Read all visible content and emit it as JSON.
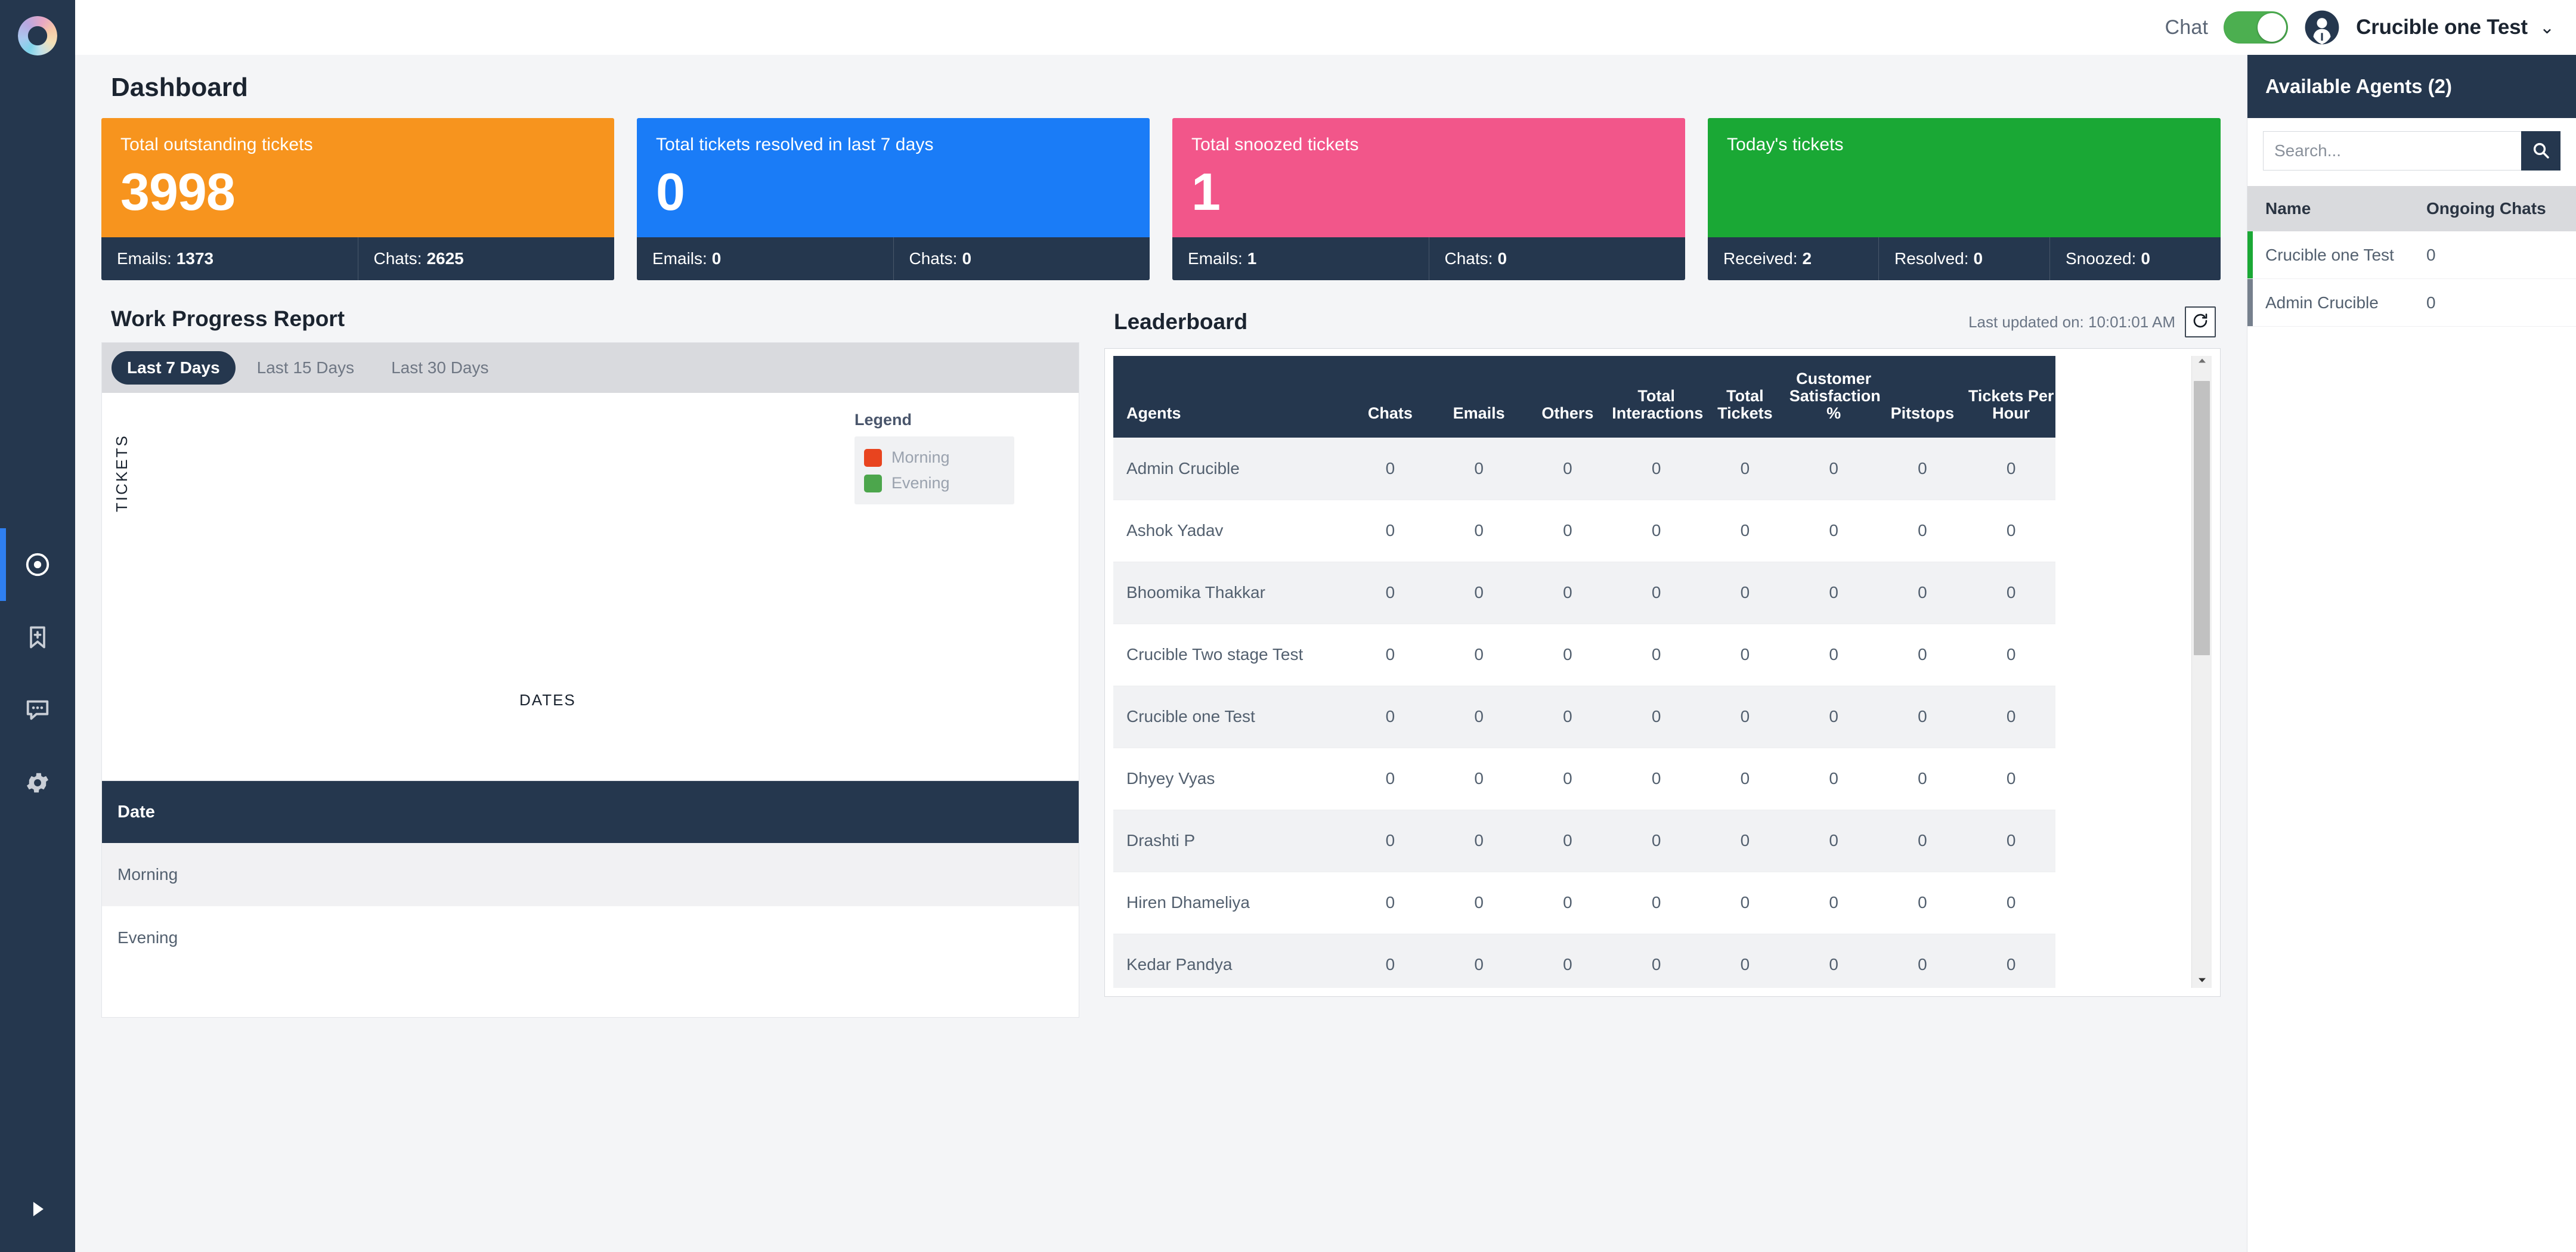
{
  "brand": {
    "logo_icon": "gradient-ring-logo"
  },
  "rail": {
    "items": [
      {
        "icon": "target-dashboard-icon",
        "name": "dashboard",
        "active": true
      },
      {
        "icon": "bookmark-plus-icon",
        "name": "saved",
        "active": false
      },
      {
        "icon": "chat-bubble-icon",
        "name": "chats",
        "active": false
      },
      {
        "icon": "gear-icon",
        "name": "settings",
        "active": false
      }
    ],
    "expand_icon": "play-triangle-icon"
  },
  "topbar": {
    "chat_label": "Chat",
    "chat_toggle_on": true,
    "avatar_icon": "user-avatar-icon",
    "user_name": "Crucible one Test",
    "caret": "⌄"
  },
  "page": {
    "title": "Dashboard"
  },
  "cards": [
    {
      "title": "Total outstanding tickets",
      "value": "3998",
      "color": "#f7941e",
      "footer": [
        {
          "label": "Emails:",
          "value": "1373"
        },
        {
          "label": "Chats:",
          "value": "2625"
        }
      ]
    },
    {
      "title": "Total tickets resolved in last 7 days",
      "value": "0",
      "color": "#1a7cf7",
      "footer": [
        {
          "label": "Emails:",
          "value": "0"
        },
        {
          "label": "Chats:",
          "value": "0"
        }
      ]
    },
    {
      "title": "Total snoozed tickets",
      "value": "1",
      "color": "#f2568a",
      "footer": [
        {
          "label": "Emails:",
          "value": "1"
        },
        {
          "label": "Chats:",
          "value": "0"
        }
      ]
    },
    {
      "title": "Today's tickets",
      "value": "",
      "color": "#1aa835",
      "footer": [
        {
          "label": "Received:",
          "value": "2"
        },
        {
          "label": "Resolved:",
          "value": "0"
        },
        {
          "label": "Snoozed:",
          "value": "0"
        }
      ]
    }
  ],
  "work_progress": {
    "title": "Work Progress Report",
    "tabs": [
      {
        "label": "Last 7 Days",
        "active": true
      },
      {
        "label": "Last 15 Days",
        "active": false
      },
      {
        "label": "Last 30 Days",
        "active": false
      }
    ],
    "legend_title": "Legend",
    "table": {
      "header": "Date",
      "rows": [
        "Morning",
        "Evening"
      ]
    }
  },
  "chart_data": {
    "type": "bar",
    "title": "Work Progress Report",
    "xlabel": "DATES",
    "ylabel": "TICKETS",
    "categories": [],
    "series": [
      {
        "name": "Morning",
        "color": "#e8441f",
        "values": []
      },
      {
        "name": "Evening",
        "color": "#4ca64c",
        "values": []
      }
    ],
    "legend": [
      "Morning",
      "Evening"
    ],
    "legend_position": "top-right",
    "grid": false,
    "empty": true
  },
  "leaderboard": {
    "title": "Leaderboard",
    "last_updated": "Last updated on: 10:01:01 AM",
    "refresh_icon": "refresh-icon",
    "columns": [
      "Agents",
      "Chats",
      "Emails",
      "Others",
      "Total Interactions",
      "Total Tickets",
      "Customer Satisfaction %",
      "Pitstops",
      "Tickets Per Hour"
    ],
    "rows": [
      {
        "agent": "Admin Crucible",
        "cells": [
          "0",
          "0",
          "0",
          "0",
          "0",
          "0",
          "0",
          "0"
        ]
      },
      {
        "agent": "Ashok Yadav",
        "cells": [
          "0",
          "0",
          "0",
          "0",
          "0",
          "0",
          "0",
          "0"
        ]
      },
      {
        "agent": "Bhoomika Thakkar",
        "cells": [
          "0",
          "0",
          "0",
          "0",
          "0",
          "0",
          "0",
          "0"
        ]
      },
      {
        "agent": "Crucible Two stage Test",
        "cells": [
          "0",
          "0",
          "0",
          "0",
          "0",
          "0",
          "0",
          "0"
        ]
      },
      {
        "agent": "Crucible one Test",
        "cells": [
          "0",
          "0",
          "0",
          "0",
          "0",
          "0",
          "0",
          "0"
        ]
      },
      {
        "agent": "Dhyey Vyas",
        "cells": [
          "0",
          "0",
          "0",
          "0",
          "0",
          "0",
          "0",
          "0"
        ]
      },
      {
        "agent": "Drashti P",
        "cells": [
          "0",
          "0",
          "0",
          "0",
          "0",
          "0",
          "0",
          "0"
        ]
      },
      {
        "agent": "Hiren Dhameliya",
        "cells": [
          "0",
          "0",
          "0",
          "0",
          "0",
          "0",
          "0",
          "0"
        ]
      },
      {
        "agent": "Kedar Pandya",
        "cells": [
          "0",
          "0",
          "0",
          "0",
          "0",
          "0",
          "0",
          "0"
        ]
      }
    ]
  },
  "available_agents": {
    "title": "Available Agents (2)",
    "search_placeholder": "Search...",
    "search_value": "",
    "search_icon": "search-icon",
    "columns": {
      "name": "Name",
      "ongoing": "Ongoing Chats"
    },
    "rows": [
      {
        "name": "Crucible one Test",
        "ongoing": "0",
        "status_color": "#1aa835"
      },
      {
        "name": "Admin Crucible",
        "ongoing": "0",
        "status_color": "#76808d"
      }
    ]
  }
}
